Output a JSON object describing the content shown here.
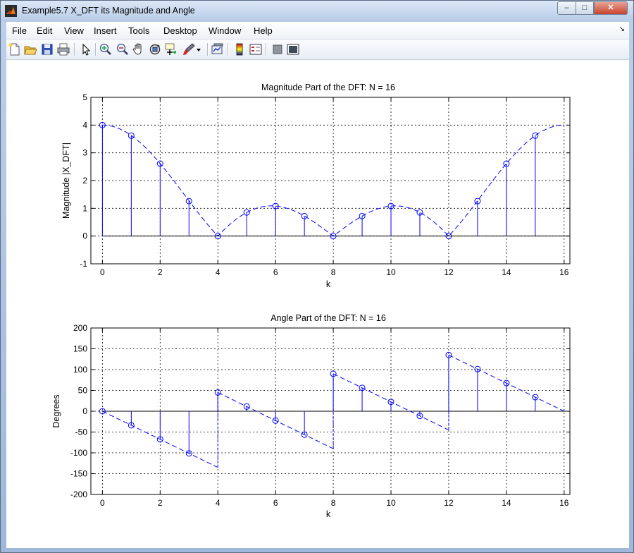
{
  "window": {
    "title": "Example5.7 X_DFT its Magnitude and Angle",
    "controls": {
      "minimize": "–",
      "maximize": "□",
      "close": "✕"
    }
  },
  "menu": {
    "items": [
      "File",
      "Edit",
      "View",
      "Insert",
      "Tools",
      "Desktop",
      "Window",
      "Help"
    ],
    "overflow_arrow": "↘"
  },
  "toolbar": {
    "icons": [
      "new-figure-icon",
      "open-file-icon",
      "save-icon",
      "print-icon",
      "edit-plot-arrow-icon",
      "zoom-in-icon",
      "zoom-out-icon",
      "pan-hand-icon",
      "rotate-3d-icon",
      "data-cursor-icon",
      "brush-icon",
      "brush-dropdown-icon",
      "link-plot-icon",
      "insert-colorbar-icon",
      "insert-legend-icon",
      "hide-plot-tools-icon",
      "show-plot-tools-icon"
    ]
  },
  "colors": {
    "stem": "#0000ff",
    "frame": "#000000",
    "grid": "#000000"
  },
  "chart_data": [
    {
      "type": "stem",
      "title": "Magnitude Part of the DFT: N = 16",
      "xlabel": "k",
      "ylabel": "Magnitude  |X_DFT|",
      "xlim": [
        -0.4,
        16.2
      ],
      "ylim": [
        -1,
        5
      ],
      "xticks": [
        "0",
        "2",
        "4",
        "6",
        "8",
        "10",
        "12",
        "14",
        "16"
      ],
      "yticks": [
        "-1",
        "0",
        "1",
        "2",
        "3",
        "4",
        "5"
      ],
      "grid": true,
      "x": [
        0,
        1,
        2,
        3,
        4,
        5,
        6,
        7,
        8,
        9,
        10,
        11,
        12,
        13,
        14,
        15
      ],
      "values": [
        4.0,
        3.62,
        2.61,
        1.26,
        0.0,
        0.85,
        1.08,
        0.72,
        0.0,
        0.72,
        1.08,
        0.85,
        0.0,
        1.26,
        2.61,
        3.62
      ],
      "overlay": "dashed continuous magnitude curve"
    },
    {
      "type": "stem",
      "title": "Angle Part of the DFT: N = 16",
      "xlabel": "k",
      "ylabel": "Degrees",
      "xlim": [
        -0.4,
        16.2
      ],
      "ylim": [
        -200,
        200
      ],
      "xticks": [
        "0",
        "2",
        "4",
        "6",
        "8",
        "10",
        "12",
        "14",
        "16"
      ],
      "yticks": [
        "-200",
        "-150",
        "-100",
        "-50",
        "0",
        "50",
        "100",
        "150",
        "200"
      ],
      "grid": true,
      "x": [
        0,
        1,
        2,
        3,
        4,
        5,
        6,
        7,
        8,
        9,
        10,
        11,
        12,
        13,
        14,
        15
      ],
      "values": [
        0,
        -33.75,
        -67.5,
        -101.25,
        45,
        11.25,
        -22.5,
        -56.25,
        90,
        56.25,
        22.5,
        -11.25,
        135,
        101.25,
        67.5,
        33.75
      ],
      "overlay": "dashed continuous phase curve"
    }
  ]
}
